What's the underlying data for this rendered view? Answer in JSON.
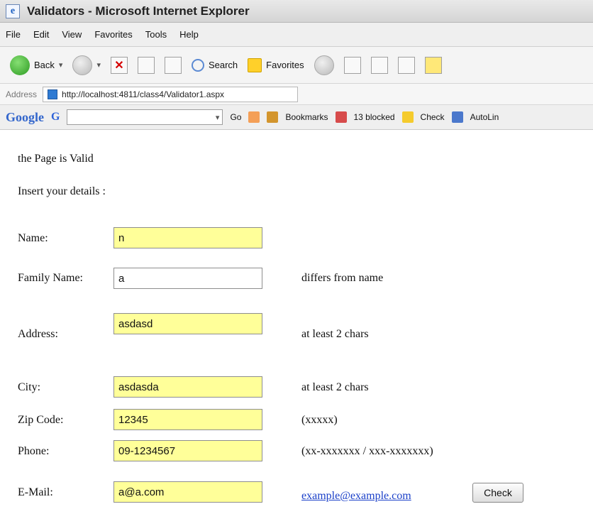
{
  "window": {
    "title": "Validators - Microsoft Internet Explorer",
    "logo_glyph": "e"
  },
  "menu": [
    "File",
    "Edit",
    "View",
    "Favorites",
    "Tools",
    "Help"
  ],
  "toolbar": {
    "back_label": "Back",
    "search_label": "Search",
    "favorites_label": "Favorites"
  },
  "address": {
    "label": "Address",
    "url": "http://localhost:4811/class4/Validator1.aspx"
  },
  "google_toolbar": {
    "brand": "Google",
    "g_glyph": "G",
    "go_label": "Go",
    "bookmarks_label": "Bookmarks",
    "blocked_label": "13 blocked",
    "check_label": "Check",
    "autolink_label": "AutoLin"
  },
  "page": {
    "status_text": "the Page is Valid",
    "intro_text": "Insert your details :",
    "fields": {
      "name": {
        "label": "Name:",
        "value": "n",
        "message": ""
      },
      "family_name": {
        "label": "Family Name:",
        "value": "a",
        "message": "differs from name"
      },
      "address": {
        "label": "Address:",
        "value": "asdasd",
        "message": "at least 2 chars"
      },
      "city": {
        "label": "City:",
        "value": "asdasda",
        "message": "at least 2 chars"
      },
      "zip_code": {
        "label": "Zip Code:",
        "value": "12345",
        "message": "(xxxxx)"
      },
      "phone": {
        "label": "Phone:",
        "value": "09-1234567",
        "message": "(xx-xxxxxxx / xxx-xxxxxxx)"
      },
      "email": {
        "label": "E-Mail:",
        "value": "a@a.com",
        "message": "example@example.com"
      }
    },
    "check_button_label": "Check"
  },
  "colors": {
    "input_highlight": "#ffff99",
    "link": "#1b40c9"
  }
}
